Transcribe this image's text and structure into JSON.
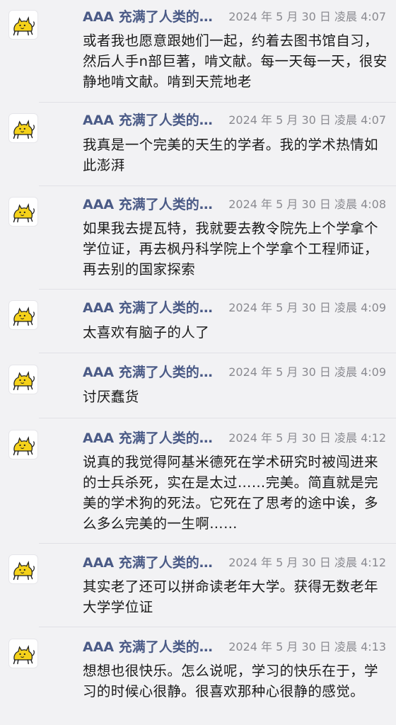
{
  "messages": [
    {
      "author": "AAA 充满了人类的…",
      "time": "2024 年 5 月 30 日 凌晨 4:07",
      "text": "或者我也愿意跟她们一起，约着去图书馆自习，然后人手n部巨著，啃文献。每一天每一天，很安静地啃文献。啃到天荒地老",
      "avatar_icon": "yellow-cat-sticker-icon"
    },
    {
      "author": "AAA 充满了人类的…",
      "time": "2024 年 5 月 30 日 凌晨 4:07",
      "text": "我真是一个完美的天生的学者。我的学术热情如此澎湃",
      "avatar_icon": "yellow-cat-sticker-icon"
    },
    {
      "author": "AAA 充满了人类的…",
      "time": "2024 年 5 月 30 日 凌晨 4:08",
      "text": "如果我去提瓦特，我就要去教令院先上个学拿个学位证，再去枫丹科学院上个学拿个工程师证，再去别的国家探索",
      "avatar_icon": "yellow-cat-sticker-icon"
    },
    {
      "author": "AAA 充满了人类的…",
      "time": "2024 年 5 月 30 日 凌晨 4:09",
      "text": "太喜欢有脑子的人了",
      "avatar_icon": "yellow-cat-sticker-icon"
    },
    {
      "author": "AAA 充满了人类的…",
      "time": "2024 年 5 月 30 日 凌晨 4:09",
      "text": "讨厌蠢货",
      "avatar_icon": "yellow-cat-sticker-icon"
    },
    {
      "author": "AAA 充满了人类的…",
      "time": "2024 年 5 月 30 日 凌晨 4:12",
      "text": "说真的我觉得阿基米德死在学术研究时被闯进来的士兵杀死，实在是太过……完美。简直就是完美的学术狗的死法。它死在了思考的途中诶，多么多么完美的一生啊……",
      "avatar_icon": "yellow-cat-sticker-icon"
    },
    {
      "author": "AAA 充满了人类的…",
      "time": "2024 年 5 月 30 日 凌晨 4:12",
      "text": "其实老了还可以拼命读老年大学。获得无数老年大学学位证",
      "avatar_icon": "yellow-cat-sticker-icon"
    },
    {
      "author": "AAA 充满了人类的…",
      "time": "2024 年 5 月 30 日 凌晨 4:13",
      "text": "想想也很快乐。怎么说呢，学习的快乐在于，学习的时候心很静。很喜欢那种心很静的感觉。",
      "avatar_icon": "yellow-cat-sticker-icon"
    }
  ],
  "colors": {
    "background": "#f2f2f4",
    "author": "#4a5a86",
    "timestamp": "#8a8a90",
    "text": "#1a1a1a",
    "avatar_yellow": "#f5d21a"
  }
}
